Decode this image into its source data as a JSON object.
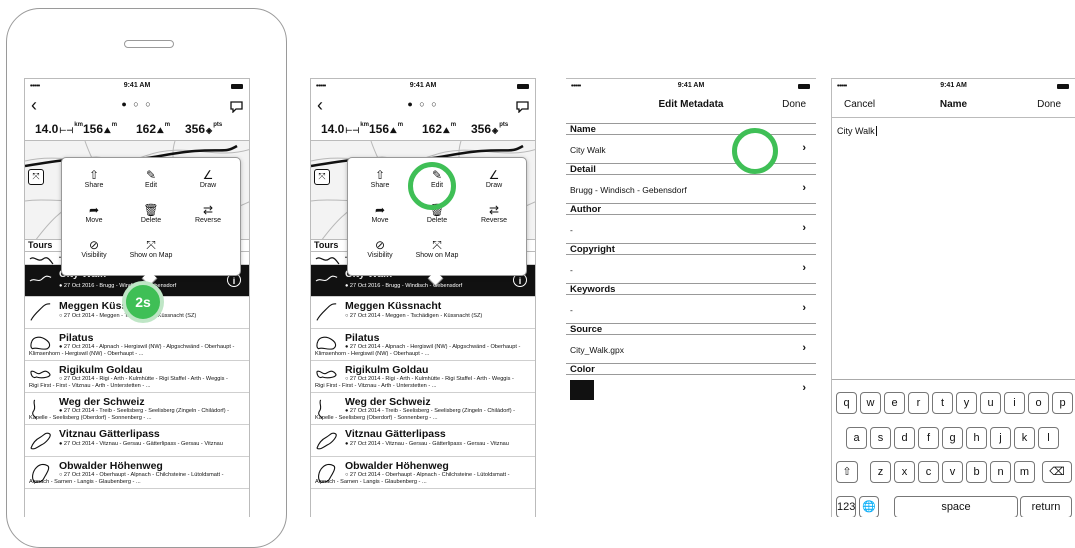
{
  "status": {
    "time": "9:41 AM",
    "dots": "•••••"
  },
  "map_screen": {
    "page_dots": "● ○ ○",
    "stats": [
      {
        "value": "14.0",
        "unit": "km"
      },
      {
        "value": "156",
        "unit": "m"
      },
      {
        "value": "162",
        "unit": "m"
      },
      {
        "value": "356",
        "unit": "pts"
      }
    ],
    "tours_label": "Tours",
    "popup_items": [
      {
        "label": "Share",
        "icon": "share-icon",
        "glyph": "⇧"
      },
      {
        "label": "Edit",
        "icon": "edit-icon",
        "glyph": "✎"
      },
      {
        "label": "Draw",
        "icon": "draw-icon",
        "glyph": "∠"
      },
      {
        "label": "Move",
        "icon": "move-icon",
        "glyph": "➦"
      },
      {
        "label": "Delete",
        "icon": "trash-icon",
        "glyph": "🗑"
      },
      {
        "label": "Reverse",
        "icon": "reverse-icon",
        "glyph": "⇄"
      },
      {
        "label": "Visibility",
        "icon": "eye-off-icon",
        "glyph": "⊘"
      },
      {
        "label": "Show on Map",
        "icon": "expand-icon",
        "glyph": "⤧"
      }
    ],
    "hold_badge": "2s",
    "tours": [
      {
        "title": "",
        "sub": "• 27 Oct 2014 - Arth -"
      },
      {
        "title": "City Walk",
        "sub": "● 27 Oct 2016 - Brugg - Windisch - Gebensdorf"
      },
      {
        "title": "Meggen Küssnacht",
        "sub": "○ 27 Oct 2014 - Meggen - Tschädigen - Küssnacht (SZ)"
      },
      {
        "title": "Pilatus",
        "sub": "● 27 Oct 2014 - Alpnach - Hergiswil (NW) - Alpgschwänd - Oberhaupt - Klimsenhorn - Hergiswil (NW) - Oberhaupt - ..."
      },
      {
        "title": "Rigikulm Goldau",
        "sub": "○ 27 Oct 2014 - Rigi - Arth - Kulmhütte - Rigi Staffel - Arth - Weggis - Rigi First - First - Vitznau - Arth - Unterstetten - ..."
      },
      {
        "title": "Weg der Schweiz",
        "sub": "● 27 Oct 2014 - Treib - Seelisberg - Seelisberg (Zingeln - Chiládorf) - Kapelle - Seelisberg (Oberdorf) - Sonnenberg - ..."
      },
      {
        "title": "Vitznau Gätterlipass",
        "sub": "● 27 Oct 2014 - Vitznau - Gersau - Gätterlipass - Gersau - Vitznau"
      },
      {
        "title": "Obwalder Höhenweg",
        "sub": "○ 27 Oct 2014 - Oberhaupt - Alpnach - Chilchsteine - Lütoldsmatt - Alpnach - Sarnen - Langis - Glaubenberg - ..."
      }
    ]
  },
  "metadata": {
    "title": "Edit Metadata",
    "done": "Done",
    "sections": [
      {
        "header": "Name",
        "value": "City Walk"
      },
      {
        "header": "Detail",
        "value": "Brugg - Windisch - Gebensdorf"
      },
      {
        "header": "Author",
        "value": "-"
      },
      {
        "header": "Copyright",
        "value": "-"
      },
      {
        "header": "Keywords",
        "value": "-"
      },
      {
        "header": "Source",
        "value": "City_Walk.gpx"
      }
    ],
    "color_header": "Color",
    "color_value": "#111111"
  },
  "name_screen": {
    "cancel": "Cancel",
    "title": "Name",
    "done": "Done",
    "value": "City Walk",
    "keys_row1": [
      "q",
      "w",
      "e",
      "r",
      "t",
      "y",
      "u",
      "i",
      "o",
      "p"
    ],
    "keys_row2": [
      "a",
      "s",
      "d",
      "f",
      "g",
      "h",
      "j",
      "k",
      "l"
    ],
    "keys_row3": [
      "z",
      "x",
      "c",
      "v",
      "b",
      "n",
      "m"
    ],
    "shift": "⇧",
    "backspace": "⌫",
    "numbers": "123",
    "globe": "🌐",
    "space": "space",
    "return": "return"
  },
  "colors": {
    "accent": "#3fbf56"
  }
}
